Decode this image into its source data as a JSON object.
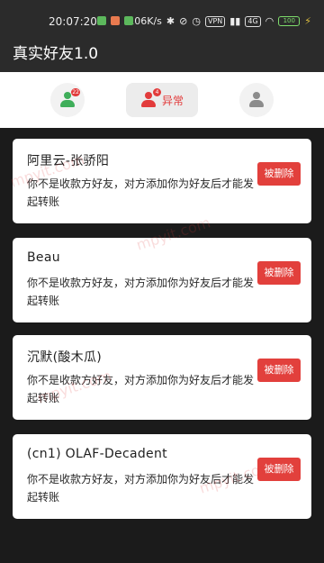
{
  "status_bar": {
    "time": "20:07:20",
    "network_speed": "106K/s",
    "vpn_label": "VPN",
    "signal_label": "4G",
    "battery_label": "100"
  },
  "app_bar": {
    "title": "真实好友1.0"
  },
  "tabs": {
    "friends_badge": "22",
    "abnormal_badge": "4",
    "abnormal_label": "异常",
    "active_color": "#e23b3b",
    "friends_icon_color": "#3fae5a",
    "profile_icon_color": "#8c8c8c"
  },
  "list": {
    "items": [
      {
        "name": "阿里云-张骄阳",
        "description": "你不是收款方好友，对方添加你为好友后才能发起转账",
        "action_label": "被删除"
      },
      {
        "name": "Beau",
        "description": "你不是收款方好友，对方添加你为好友后才能发起转账",
        "action_label": "被删除"
      },
      {
        "name": "沉默(酸木瓜)",
        "description": "你不是收款方好友，对方添加你为好友后才能发起转账",
        "action_label": "被删除"
      },
      {
        "name": "(cn1) OLAF-Decadent",
        "description": "你不是收款方好友，对方添加你为好友后才能发起转账",
        "action_label": "被删除"
      }
    ]
  },
  "watermark_text": "mpyit.com"
}
